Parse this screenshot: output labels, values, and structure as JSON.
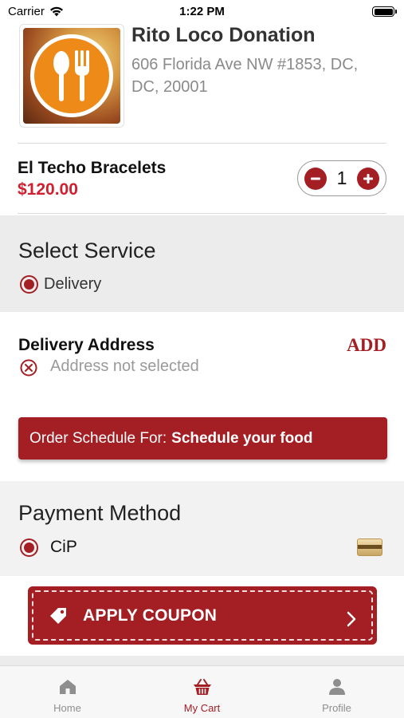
{
  "status_bar": {
    "carrier": "Carrier",
    "time": "1:22 PM",
    "battery_level": 1.0
  },
  "restaurant": {
    "name": "Rito Loco Donation",
    "address": "606 Florida Ave NW #1853, DC, DC, 20001",
    "logo_icon": "fork-spoon-icon"
  },
  "cart_item": {
    "name": "El Techo Bracelets",
    "price": "$120.00",
    "quantity": "1"
  },
  "service": {
    "title": "Select Service",
    "selected_option": "Delivery"
  },
  "delivery_address": {
    "title": "Delivery Address",
    "add_label": "ADD",
    "status": "Address not selected"
  },
  "schedule": {
    "prefix": "Order Schedule For:",
    "value": "Schedule your food"
  },
  "payment": {
    "title": "Payment Method",
    "selected_method": "CiP",
    "method_icon": "credit-card-icon"
  },
  "coupon": {
    "label": "APPLY COUPON"
  },
  "tabbar": {
    "items": [
      {
        "label": "Home",
        "icon": "home-icon",
        "active": false
      },
      {
        "label": "My Cart",
        "icon": "basket-icon",
        "active": true
      },
      {
        "label": "Profile",
        "icon": "person-icon",
        "active": false
      }
    ]
  },
  "colors": {
    "accent": "#a31f24",
    "price": "#d0202f",
    "logo_orange": "#ee8a17"
  }
}
